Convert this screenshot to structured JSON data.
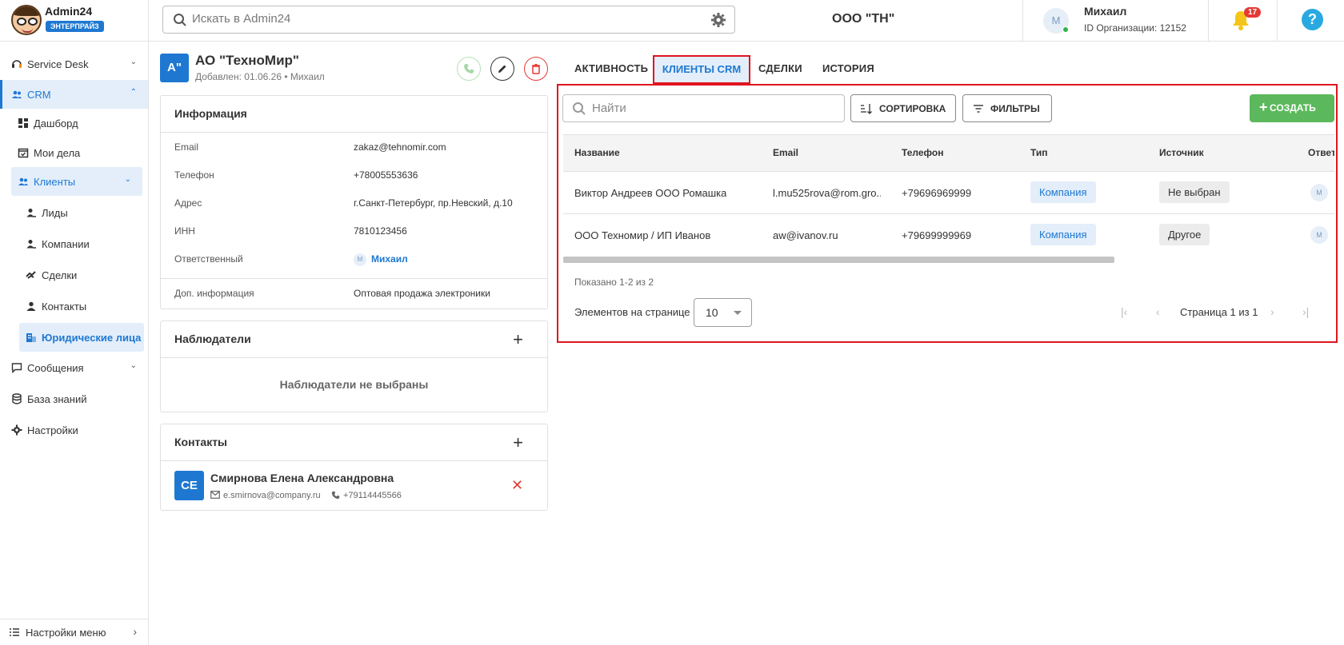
{
  "header": {
    "app_name": "Admin24",
    "app_badge": "ЭНТЕРПРАЙЗ",
    "search_placeholder": "Искать в Admin24",
    "org_name": "ООО \"ТН\"",
    "user_avatar": "М",
    "user_name": "Михаил",
    "org_id_label": "ID Организации: 12152",
    "notification_count": "17",
    "help_label": "?"
  },
  "sidebar": {
    "items": [
      {
        "label": "Service Desk",
        "icon": "headset-icon"
      },
      {
        "label": "CRM",
        "icon": "users-icon"
      },
      {
        "label": "Дашборд",
        "icon": "dashboard-icon"
      },
      {
        "label": "Мои дела",
        "icon": "calendar-check-icon"
      },
      {
        "label": "Клиенты",
        "icon": "users-icon"
      },
      {
        "label": "Лиды",
        "icon": "lead-icon"
      },
      {
        "label": "Компании",
        "icon": "company-icon"
      },
      {
        "label": "Сделки",
        "icon": "handshake-icon"
      },
      {
        "label": "Контакты",
        "icon": "person-icon"
      },
      {
        "label": "Юридические лица",
        "icon": "building-icon"
      },
      {
        "label": "Сообщения",
        "icon": "chat-icon"
      },
      {
        "label": "База знаний",
        "icon": "database-icon"
      },
      {
        "label": "Настройки",
        "icon": "gear-icon"
      }
    ],
    "footer_label": "Настройки меню"
  },
  "entity": {
    "avatar": "А\"",
    "name": "АО \"ТехноМир\"",
    "meta": "Добавлен: 01.06.26 • Михаил"
  },
  "info_card": {
    "title": "Информация",
    "rows": [
      {
        "key": "Email",
        "value": "zakaz@tehnomir.com"
      },
      {
        "key": "Телефон",
        "value": "+78005553636"
      },
      {
        "key": "Адрес",
        "value": "г.Санкт-Петербург, пр.Невский, д.10"
      },
      {
        "key": "ИНН",
        "value": "7810123456"
      },
      {
        "key": "Ответственный",
        "value": "Михаил",
        "avatar": "М"
      },
      {
        "key": "Доп. информация",
        "value": "Оптовая продажа электроники"
      }
    ]
  },
  "observers_card": {
    "title": "Наблюдатели",
    "empty": "Наблюдатели не выбраны"
  },
  "contacts_card": {
    "title": "Контакты",
    "contact": {
      "initials": "СЕ",
      "name": "Смирнова Елена Александровна",
      "email": "e.smirnova@company.ru",
      "phone": "+79114445566"
    }
  },
  "tabs": [
    "АКТИВНОСТЬ",
    "КЛИЕНТЫ CRM",
    "СДЕЛКИ",
    "ИСТОРИЯ"
  ],
  "active_tab": "КЛИЕНТЫ CRM",
  "toolbar": {
    "find_placeholder": "Найти",
    "sort_label": "СОРТИРОВКА",
    "filter_label": "ФИЛЬТРЫ",
    "create_label": "СОЗДАТЬ"
  },
  "table": {
    "columns": [
      "Название",
      "Email",
      "Телефон",
      "Тип",
      "Источник",
      "Ответ"
    ],
    "rows": [
      {
        "name": "Виктор Андреев ООО Ромашка",
        "email": "l.mu525rova@rom.gro...",
        "phone": "+79696969999",
        "type": "Компания",
        "source": "Не выбран",
        "owner": "М"
      },
      {
        "name": "ООО Техномир / ИП Иванов",
        "email": "aw@ivanov.ru",
        "phone": "+79699999969",
        "type": "Компания",
        "source": "Другое",
        "owner": "М"
      }
    ]
  },
  "pagination": {
    "shown": "Показано 1-2 из 2",
    "per_page_label": "Элементов на странице",
    "per_page_value": "10",
    "page_label": "Страница 1 из 1"
  },
  "colors": {
    "accent": "#1e78d2",
    "highlight_frame": "#e0141e",
    "create_button": "#5cb85c",
    "badge": "#e53935"
  }
}
